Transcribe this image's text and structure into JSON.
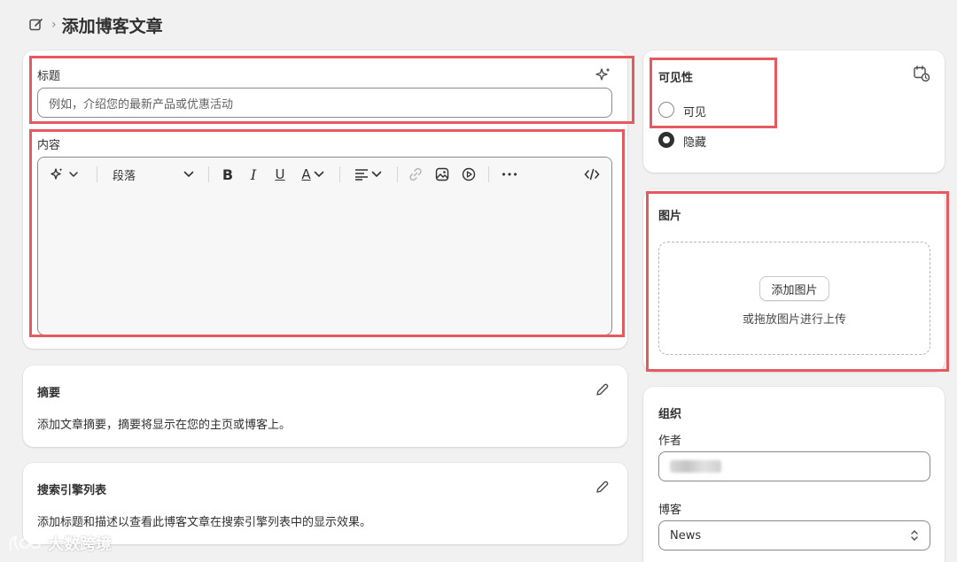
{
  "header": {
    "title": "添加博客文章"
  },
  "title_section": {
    "label": "标题",
    "placeholder": "例如，介绍您的最新产品或优惠活动"
  },
  "content_section": {
    "label": "内容",
    "toolbar": {
      "paragraph_label": "段落",
      "bold": "B",
      "italic": "I",
      "underline": "U",
      "text_color": "A",
      "more": "•••"
    }
  },
  "summary": {
    "label": "摘要",
    "text": "添加文章摘要，摘要将显示在您的主页或博客上。"
  },
  "seo": {
    "label": "搜索引擎列表",
    "text": "添加标题和描述以查看此博客文章在搜索引擎列表中的显示效果。"
  },
  "visibility": {
    "label": "可见性",
    "options": [
      {
        "label": "可见",
        "selected": false
      },
      {
        "label": "隐藏",
        "selected": true
      }
    ]
  },
  "image": {
    "label": "图片",
    "add_button": "添加图片",
    "hint": "或拖放图片进行上传"
  },
  "organization": {
    "label": "组织",
    "author_label": "作者",
    "blog_label": "博客",
    "blog_value": "News"
  },
  "watermark": {
    "text": "大数跨境"
  },
  "colors": {
    "highlight": "#e65a5f",
    "background": "#f1f1f1",
    "card": "#ffffff",
    "text": "#303030"
  }
}
